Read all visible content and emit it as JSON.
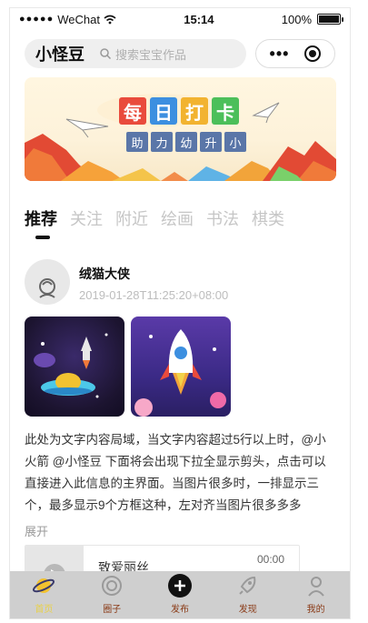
{
  "status_bar": {
    "signal": "●●●●●",
    "carrier": "WeChat",
    "time": "15:14",
    "battery": "100%"
  },
  "nav": {
    "app_name": "小怪豆",
    "search_placeholder": "搜索宝宝作品",
    "more_glyph": "•••"
  },
  "banner": {
    "title_chars": [
      "每",
      "日",
      "打",
      "卡"
    ],
    "title_colors": [
      "#e94b3c",
      "#3c8fe0",
      "#f2b330",
      "#4cbf5a"
    ],
    "subtitle_chars": [
      "助",
      "力",
      "幼",
      "升",
      "小"
    ]
  },
  "tabs": [
    {
      "label": "推荐",
      "active": true
    },
    {
      "label": "关注",
      "active": false
    },
    {
      "label": "附近",
      "active": false
    },
    {
      "label": "绘画",
      "active": false
    },
    {
      "label": "书法",
      "active": false
    },
    {
      "label": "棋类",
      "active": false
    }
  ],
  "post": {
    "username": "绒猫大侠",
    "timestamp": "2019-01-28T11:25:20+08:00",
    "text": "此处为文字内容局域，当文字内容超过5行以上时，@小火箭 @小怪豆 下面将会出现下拉全显示剪头，点击可以直接进入此信息的主界面。当图片很多时，一排显示三个，最多显示9个方框这种，左对齐当图片很多多多",
    "expand_label": "展开",
    "audio": {
      "title": "致爱丽丝",
      "duration": "00:00"
    }
  },
  "tabbar": [
    {
      "label": "首页",
      "icon": "planet-icon",
      "active": true
    },
    {
      "label": "圈子",
      "icon": "circle-icon",
      "active": false
    },
    {
      "label": "发布",
      "icon": "plus-icon",
      "active": false
    },
    {
      "label": "发现",
      "icon": "rocket-icon",
      "active": false
    },
    {
      "label": "我的",
      "icon": "profile-icon",
      "active": false
    }
  ],
  "colors": {
    "accent": "#111111",
    "tabbar_bg": "#cfcfcf",
    "tabbar_label": "#8a3a16",
    "tabbar_active": "#e8d04a"
  }
}
